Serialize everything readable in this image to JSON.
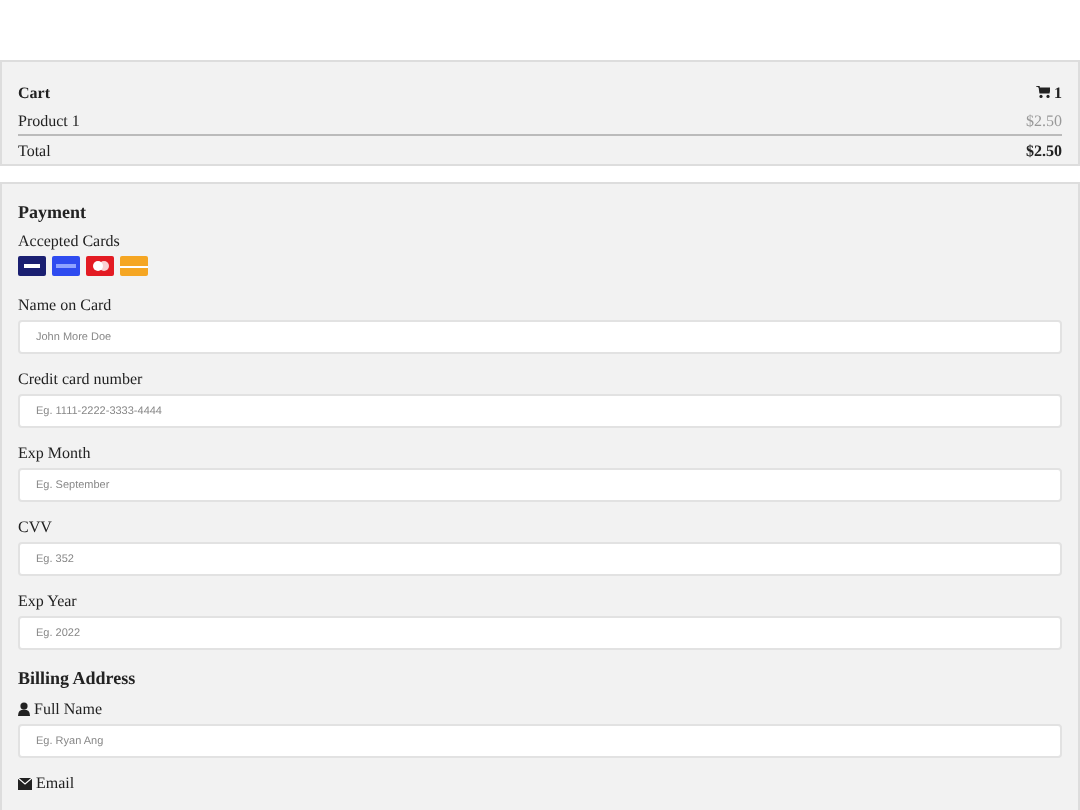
{
  "cart": {
    "title": "Cart",
    "count": "1",
    "items": [
      {
        "name": "Product 1",
        "price": "$2.50"
      }
    ],
    "total_label": "Total",
    "total": "$2.50"
  },
  "payment": {
    "title": "Payment",
    "accepted_label": "Accepted Cards",
    "cards": [
      {
        "kind": "visa"
      },
      {
        "kind": "amex"
      },
      {
        "kind": "mastercard"
      },
      {
        "kind": "discover"
      }
    ],
    "fields": [
      {
        "label": "Name on Card",
        "placeholder": "John More Doe"
      },
      {
        "label": "Credit card number",
        "placeholder": "Eg. 1111-2222-3333-4444"
      },
      {
        "label": "Exp Month",
        "placeholder": "Eg. September"
      },
      {
        "label": "CVV",
        "placeholder": "Eg. 352"
      },
      {
        "label": "Exp Year",
        "placeholder": "Eg. 2022"
      }
    ]
  },
  "billing": {
    "title": "Billing Address",
    "fields": [
      {
        "kind": "name",
        "label": "Full Name",
        "placeholder": "Eg. Ryan Ang"
      },
      {
        "kind": "email",
        "label": "Email"
      }
    ]
  }
}
